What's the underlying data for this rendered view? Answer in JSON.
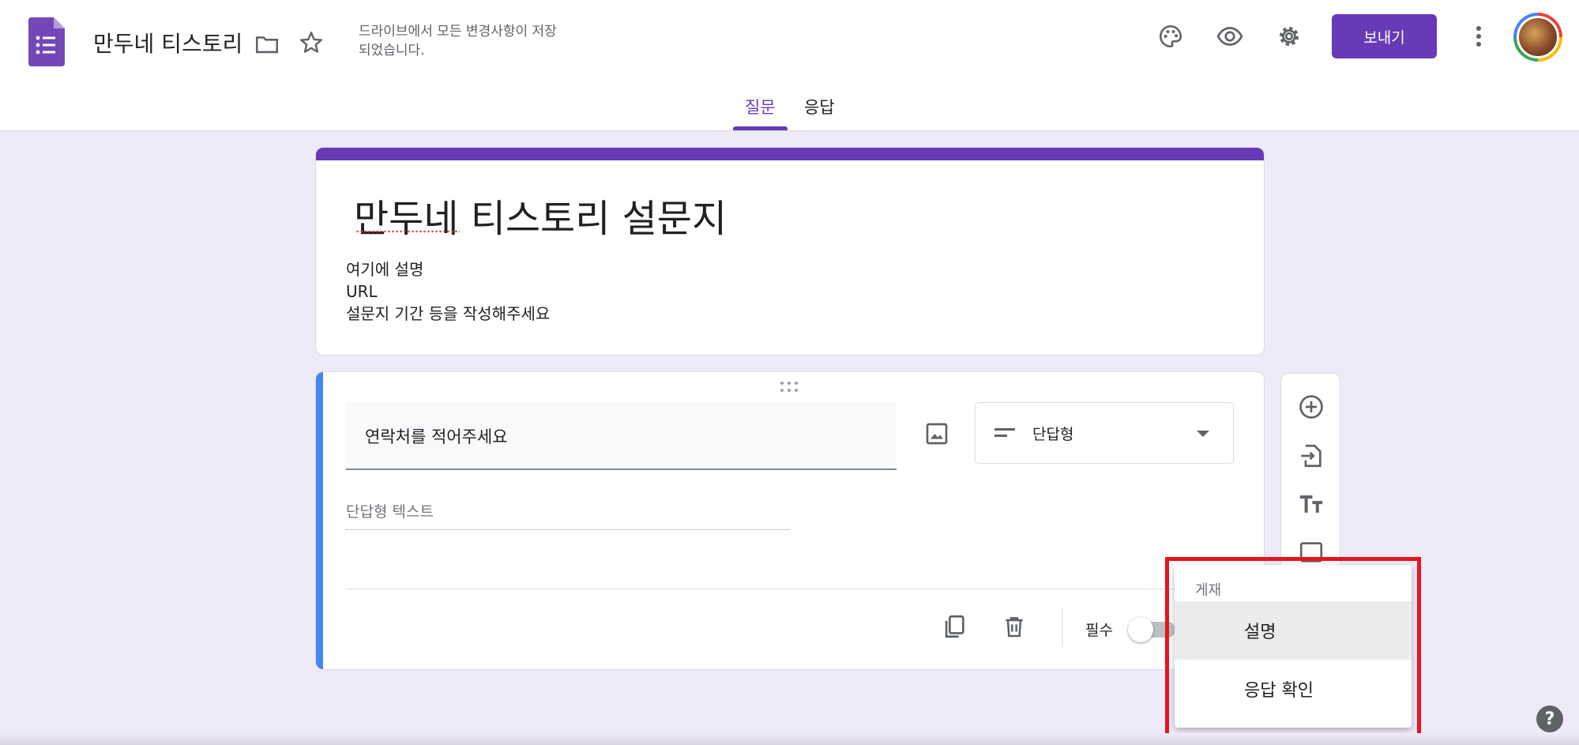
{
  "header": {
    "doc_title": "만두네 티스토리",
    "save_status": "드라이브에서 모든 변경사항이 저장되었습니다.",
    "send_label": "보내기"
  },
  "tabs": [
    {
      "label": "질문",
      "active": true
    },
    {
      "label": "응답",
      "active": false
    }
  ],
  "form": {
    "title": "만두네 티스토리 설문지",
    "description_lines": [
      "여기에 설명",
      "URL",
      "설문지 기간 등을 작성해주세요"
    ]
  },
  "question": {
    "title": "연락처를 적어주세요",
    "type_label": "단답형",
    "answer_placeholder": "단답형 텍스트",
    "required_label": "필수",
    "required_on": false
  },
  "menu": {
    "header": "게재",
    "items": [
      {
        "label": "설명",
        "selected": true
      },
      {
        "label": "응답 확인",
        "selected": false
      }
    ]
  },
  "help_label": "?",
  "colors": {
    "accent": "#673ab7",
    "question_accent": "#4285f4",
    "background": "#efeaf8",
    "highlight_box": "#e8141c"
  },
  "icons": [
    "forms-app-icon",
    "folder-icon",
    "star-icon",
    "palette-icon",
    "eye-icon",
    "gear-icon",
    "more-vert-icon",
    "image-icon",
    "short-text-icon",
    "copy-icon",
    "trash-icon",
    "add-circle-icon",
    "import-icon",
    "text-title-icon",
    "image-placeholder-icon"
  ]
}
